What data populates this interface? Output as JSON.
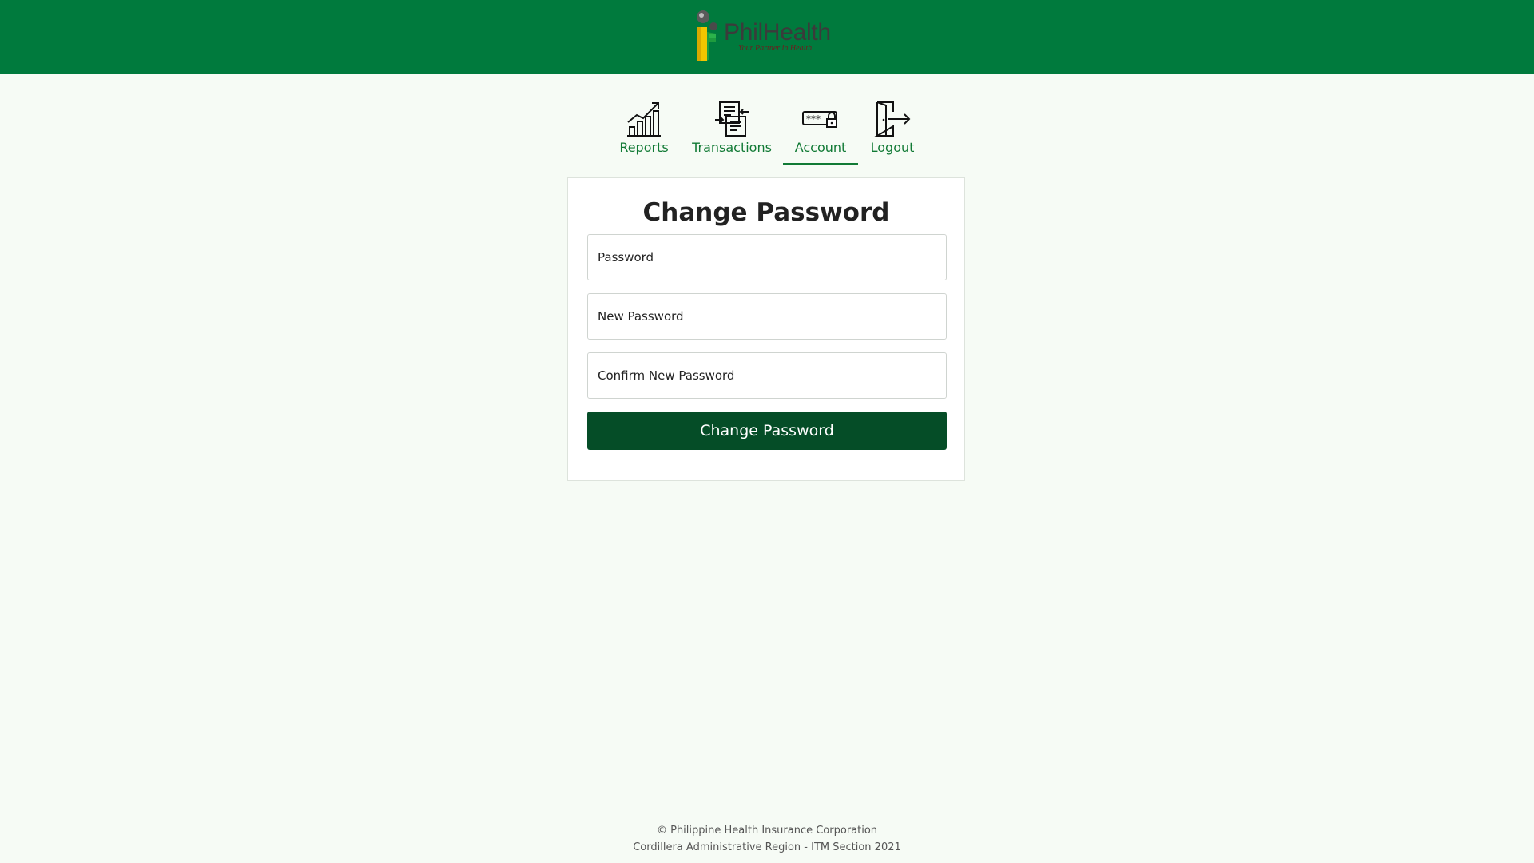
{
  "brand": {
    "name": "PhilHealth",
    "tagline": "Your Partner in Health",
    "header_color": "#007a3d"
  },
  "nav": {
    "items": [
      {
        "label": "Reports",
        "icon": "bar-chart-trend-icon"
      },
      {
        "label": "Transactions",
        "icon": "documents-transfer-icon"
      },
      {
        "label": "Account",
        "icon": "password-lock-icon",
        "active": true
      },
      {
        "label": "Logout",
        "icon": "door-exit-icon"
      }
    ]
  },
  "form": {
    "title": "Change Password",
    "password_placeholder": "Password",
    "new_password_placeholder": "New Password",
    "confirm_password_placeholder": "Confirm New Password",
    "submit_label": "Change Password"
  },
  "footer": {
    "line1": "© Philippine Health Insurance Corporation",
    "line2": "Cordillera Administrative Region - ITM Section 2021"
  },
  "colors": {
    "accent": "#117a35",
    "button": "#054d27",
    "page_background": "#f6fbf5"
  }
}
